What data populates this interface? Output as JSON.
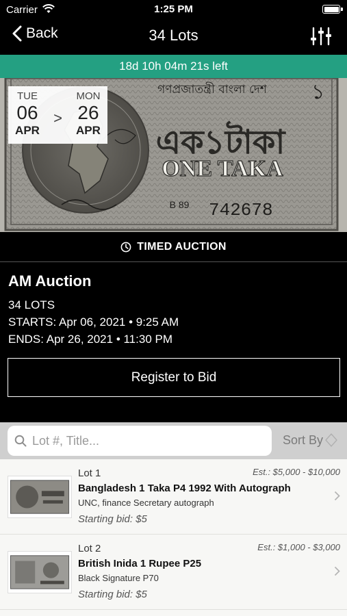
{
  "status_bar": {
    "carrier": "Carrier",
    "time": "1:25 PM"
  },
  "nav": {
    "back_label": "Back",
    "title": "34 Lots"
  },
  "countdown": "18d 10h 04m 21s left",
  "hero": {
    "banknote_header": "গণপ্রজাতন্ত্রী বাংলা দেশ",
    "banknote_value_bn": "এক১টাকা",
    "banknote_value_en": "ONE TAKA",
    "banknote_serial_prefix": "B\n89",
    "banknote_serial": "742678"
  },
  "dates": {
    "start": {
      "dow": "TUE",
      "day": "06",
      "month": "APR"
    },
    "arrow": ">",
    "end": {
      "dow": "MON",
      "day": "26",
      "month": "APR"
    }
  },
  "auction_type": "TIMED AUCTION",
  "auction": {
    "name": "AM Auction",
    "lots": "34 LOTS",
    "starts": "STARTS: Apr 06, 2021 • 9:25 AM",
    "ends": "ENDS: Apr 26, 2021 • 11:30 PM",
    "register_label": "Register to Bid"
  },
  "search": {
    "placeholder": "Lot #, Title...",
    "value": "",
    "sort_label": "Sort By"
  },
  "lots": [
    {
      "number": "Lot 1",
      "estimate": "Est.: $5,000 - $10,000",
      "title": "Bangladesh 1 Taka P4 1992 With Autograph",
      "subtitle": "UNC, finance Secretary autograph",
      "starting_bid": "Starting bid: $5"
    },
    {
      "number": "Lot 2",
      "estimate": "Est.: $1,000 - $3,000",
      "title": "British Inida 1 Rupee P25",
      "subtitle": "Black Signature P70",
      "starting_bid": "Starting bid: $5"
    }
  ],
  "colors": {
    "accent": "#24a082",
    "background": "#000000",
    "list_background": "#f7f7f5"
  }
}
